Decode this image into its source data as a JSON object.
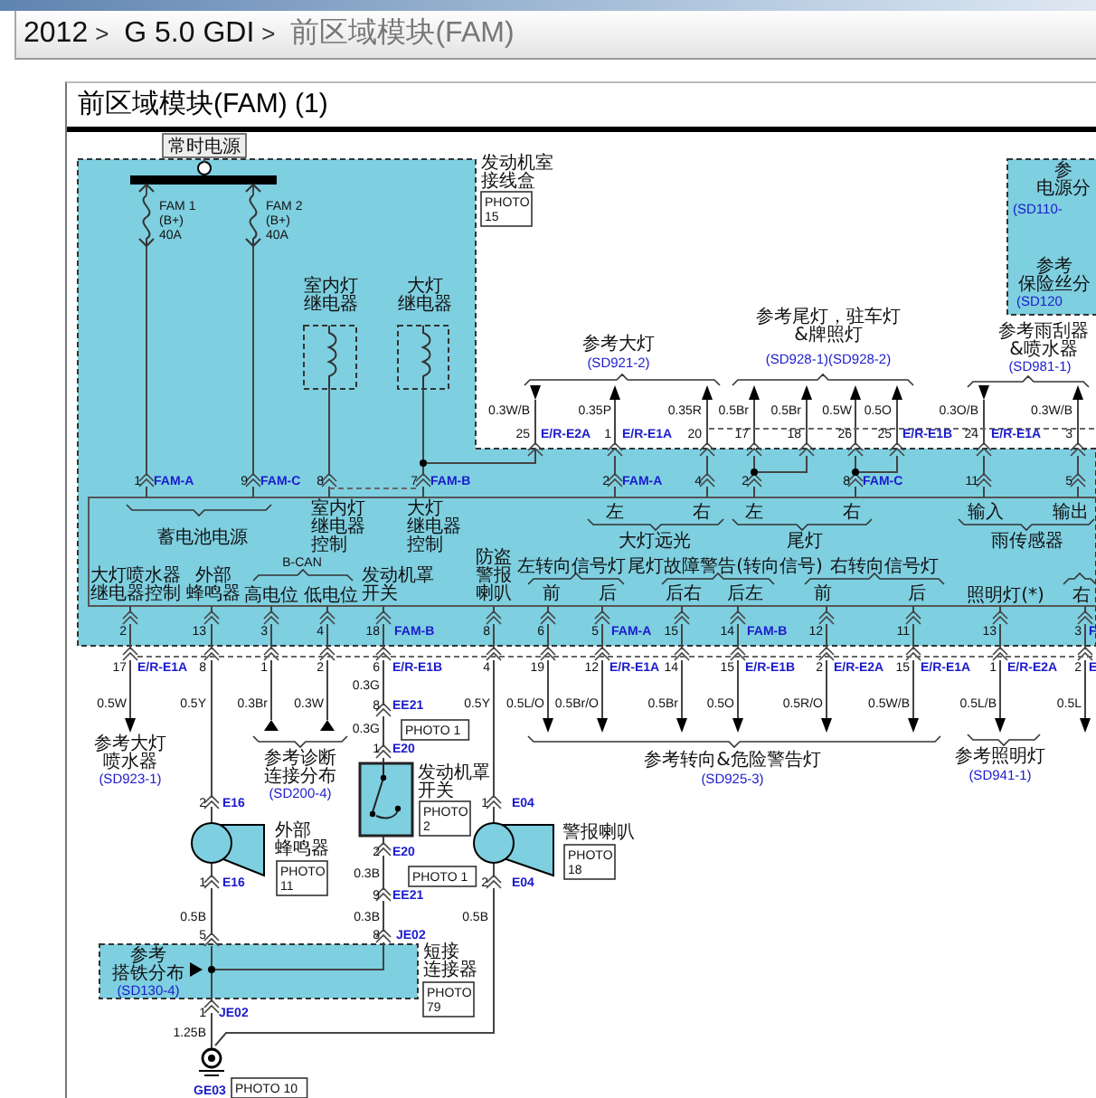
{
  "breadcrumb": {
    "separator": ">",
    "items": [
      {
        "text": "2012",
        "current": false
      },
      {
        "text": "G 5.0 GDI",
        "current": false
      },
      {
        "text": "前区域模块(FAM)",
        "current": true
      }
    ]
  },
  "panel": {
    "title": "前区域模块(FAM) (1)"
  },
  "diagram": {
    "labels": [
      {
        "kind": "tag",
        "text": "常时电源"
      },
      {
        "kind": "code",
        "lines": [
          "FAM 1",
          "(B+)",
          "40A"
        ]
      },
      {
        "kind": "code",
        "lines": [
          "FAM 2",
          "(B+)",
          "40A"
        ]
      },
      {
        "kind": "label",
        "lines": [
          "发动机室",
          "接线盒"
        ]
      },
      {
        "kind": "photo",
        "lines": [
          "PHOTO",
          "15"
        ]
      },
      {
        "kind": "label",
        "lines": [
          "室内灯",
          "继电器"
        ]
      },
      {
        "kind": "label",
        "lines": [
          "大灯",
          "继电器"
        ]
      },
      {
        "kind": "label",
        "lines": [
          "参",
          "电源分"
        ]
      },
      {
        "kind": "ref",
        "text": "(SD110-"
      },
      {
        "kind": "label",
        "lines": [
          "参考",
          "保险丝分"
        ]
      },
      {
        "kind": "ref",
        "text": "(SD120"
      },
      {
        "kind": "label",
        "text": "参考大灯"
      },
      {
        "kind": "ref",
        "text": "(SD921-2)"
      },
      {
        "kind": "label",
        "lines": [
          "参考尾灯，驻车灯",
          "&牌照灯"
        ]
      },
      {
        "kind": "ref",
        "text": "(SD928-1)(SD928-2)"
      },
      {
        "kind": "label",
        "lines": [
          "参考雨刮器",
          "&喷水器"
        ]
      },
      {
        "kind": "ref",
        "text": "(SD981-1)"
      },
      {
        "kind": "code",
        "text": "0.3W/B"
      },
      {
        "kind": "code",
        "text": "0.35P"
      },
      {
        "kind": "code",
        "text": "0.35R"
      },
      {
        "kind": "code",
        "text": "0.5Br"
      },
      {
        "kind": "code",
        "text": "0.5Br"
      },
      {
        "kind": "code",
        "text": "0.5W"
      },
      {
        "kind": "code",
        "text": "0.5O"
      },
      {
        "kind": "code",
        "text": "0.3O/B"
      },
      {
        "kind": "code",
        "text": "0.3W/B"
      },
      {
        "kind": "code",
        "text": "25"
      },
      {
        "kind": "connector",
        "text": "E/R-E2A"
      },
      {
        "kind": "code",
        "text": "1"
      },
      {
        "kind": "connector",
        "text": "E/R-E1A"
      },
      {
        "kind": "code",
        "text": "20"
      },
      {
        "kind": "code",
        "text": "17"
      },
      {
        "kind": "code",
        "text": "18"
      },
      {
        "kind": "code",
        "text": "26"
      },
      {
        "kind": "code",
        "text": "25"
      },
      {
        "kind": "connector",
        "text": "E/R-E1B"
      },
      {
        "kind": "code",
        "text": "24"
      },
      {
        "kind": "connector",
        "text": "E/R-E1A"
      },
      {
        "kind": "code",
        "text": "3"
      },
      {
        "kind": "code",
        "text": "1"
      },
      {
        "kind": "connector",
        "text": "FAM-A"
      },
      {
        "kind": "code",
        "text": "9"
      },
      {
        "kind": "connector",
        "text": "FAM-C"
      },
      {
        "kind": "code",
        "text": "8"
      },
      {
        "kind": "code",
        "text": "7"
      },
      {
        "kind": "connector",
        "text": "FAM-B"
      },
      {
        "kind": "code",
        "text": "2"
      },
      {
        "kind": "connector",
        "text": "FAM-A"
      },
      {
        "kind": "code",
        "text": "4"
      },
      {
        "kind": "code",
        "text": "2"
      },
      {
        "kind": "code",
        "text": "8"
      },
      {
        "kind": "connector",
        "text": "FAM-C"
      },
      {
        "kind": "code",
        "text": "11"
      },
      {
        "kind": "code",
        "text": "5"
      },
      {
        "kind": "label",
        "text": "蓄电池电源"
      },
      {
        "kind": "label",
        "lines": [
          "室内灯",
          "继电器",
          "控制"
        ]
      },
      {
        "kind": "label",
        "lines": [
          "大灯",
          "继电器",
          "控制"
        ]
      },
      {
        "kind": "label",
        "text": "左"
      },
      {
        "kind": "label",
        "text": "右"
      },
      {
        "kind": "label",
        "text": "左"
      },
      {
        "kind": "label",
        "text": "右"
      },
      {
        "kind": "label",
        "text": "大灯远光"
      },
      {
        "kind": "label",
        "text": "尾灯"
      },
      {
        "kind": "label",
        "text": "输入"
      },
      {
        "kind": "label",
        "text": "输出"
      },
      {
        "kind": "label",
        "text": "雨传感器"
      },
      {
        "kind": "label",
        "lines": [
          "大灯喷水器",
          "继电器控制"
        ]
      },
      {
        "kind": "label",
        "lines": [
          "外部",
          "蜂鸣器"
        ]
      },
      {
        "kind": "code",
        "text": "B-CAN"
      },
      {
        "kind": "label",
        "text": "高电位"
      },
      {
        "kind": "label",
        "text": "低电位"
      },
      {
        "kind": "label",
        "lines": [
          "发动机罩",
          "开关"
        ]
      },
      {
        "kind": "label",
        "lines": [
          "防盗",
          "警报",
          "喇叭"
        ]
      },
      {
        "kind": "label",
        "text": "左转向信号灯"
      },
      {
        "kind": "label",
        "text": "前"
      },
      {
        "kind": "label",
        "text": "后"
      },
      {
        "kind": "label",
        "text": "尾灯故障警告(转向信号)"
      },
      {
        "kind": "label",
        "text": "后右"
      },
      {
        "kind": "label",
        "text": "后左"
      },
      {
        "kind": "label",
        "text": "右转向信号灯"
      },
      {
        "kind": "label",
        "text": "前"
      },
      {
        "kind": "label",
        "text": "后"
      },
      {
        "kind": "label",
        "text": "照明灯(*)"
      },
      {
        "kind": "label",
        "text": "右"
      },
      {
        "kind": "code",
        "text": "2"
      },
      {
        "kind": "code",
        "text": "13"
      },
      {
        "kind": "code",
        "text": "3"
      },
      {
        "kind": "code",
        "text": "4"
      },
      {
        "kind": "code",
        "text": "18"
      },
      {
        "kind": "connector",
        "text": "FAM-B"
      },
      {
        "kind": "code",
        "text": "8"
      },
      {
        "kind": "code",
        "text": "6"
      },
      {
        "kind": "code",
        "text": "5"
      },
      {
        "kind": "connector",
        "text": "FAM-A"
      },
      {
        "kind": "code",
        "text": "15"
      },
      {
        "kind": "code",
        "text": "14"
      },
      {
        "kind": "connector",
        "text": "FAM-B"
      },
      {
        "kind": "code",
        "text": "12"
      },
      {
        "kind": "code",
        "text": "11"
      },
      {
        "kind": "code",
        "text": "13"
      },
      {
        "kind": "code",
        "text": "3"
      },
      {
        "kind": "connector",
        "text": "F"
      },
      {
        "kind": "code",
        "text": "17"
      },
      {
        "kind": "connector",
        "text": "E/R-E1A"
      },
      {
        "kind": "code",
        "text": "8"
      },
      {
        "kind": "code",
        "text": "1"
      },
      {
        "kind": "code",
        "text": "2"
      },
      {
        "kind": "code",
        "text": "6"
      },
      {
        "kind": "connector",
        "text": "E/R-E1B"
      },
      {
        "kind": "code",
        "text": "4"
      },
      {
        "kind": "code",
        "text": "19"
      },
      {
        "kind": "code",
        "text": "12"
      },
      {
        "kind": "connector",
        "text": "E/R-E1A"
      },
      {
        "kind": "code",
        "text": "14"
      },
      {
        "kind": "code",
        "text": "15"
      },
      {
        "kind": "connector",
        "text": "E/R-E1B"
      },
      {
        "kind": "code",
        "text": "2"
      },
      {
        "kind": "connector",
        "text": "E/R-E2A"
      },
      {
        "kind": "code",
        "text": "15"
      },
      {
        "kind": "connector",
        "text": "E/R-E1A"
      },
      {
        "kind": "code",
        "text": "1"
      },
      {
        "kind": "connector",
        "text": "E/R-E2A"
      },
      {
        "kind": "code",
        "text": "2"
      },
      {
        "kind": "connector",
        "text": "E"
      },
      {
        "kind": "code",
        "text": "0.5W"
      },
      {
        "kind": "code",
        "text": "0.5Y"
      },
      {
        "kind": "code",
        "text": "0.3Br"
      },
      {
        "kind": "code",
        "text": "0.3W"
      },
      {
        "kind": "code",
        "text": "0.3G"
      },
      {
        "kind": "code",
        "text": "0.5Y"
      },
      {
        "kind": "code",
        "text": "0.5L/O"
      },
      {
        "kind": "code",
        "text": "0.5Br/O"
      },
      {
        "kind": "code",
        "text": "0.5Br"
      },
      {
        "kind": "code",
        "text": "0.5O"
      },
      {
        "kind": "code",
        "text": "0.5R/O"
      },
      {
        "kind": "code",
        "text": "0.5W/B"
      },
      {
        "kind": "code",
        "text": "0.5L/B"
      },
      {
        "kind": "code",
        "text": "0.5L"
      },
      {
        "kind": "label",
        "lines": [
          "参考大灯",
          "喷水器"
        ]
      },
      {
        "kind": "ref",
        "text": "(SD923-1)"
      },
      {
        "kind": "label",
        "lines": [
          "参考诊断",
          "连接分布"
        ]
      },
      {
        "kind": "ref",
        "text": "(SD200-4)"
      },
      {
        "kind": "label",
        "text": "参考转向&危险警告灯"
      },
      {
        "kind": "ref",
        "text": "(SD925-3)"
      },
      {
        "kind": "label",
        "text": "参考照明灯"
      },
      {
        "kind": "ref",
        "text": "(SD941-1)"
      },
      {
        "kind": "code",
        "text": "8"
      },
      {
        "kind": "connector",
        "text": "EE21"
      },
      {
        "kind": "photo",
        "text": "PHOTO 1"
      },
      {
        "kind": "code",
        "text": "0.3G"
      },
      {
        "kind": "code",
        "text": "1"
      },
      {
        "kind": "connector",
        "text": "E20"
      },
      {
        "kind": "label",
        "lines": [
          "发动机罩",
          "开关"
        ]
      },
      {
        "kind": "photo",
        "lines": [
          "PHOTO",
          "2"
        ]
      },
      {
        "kind": "code",
        "text": "2"
      },
      {
        "kind": "connector",
        "text": "E20"
      },
      {
        "kind": "code",
        "text": "0.3B"
      },
      {
        "kind": "photo",
        "text": "PHOTO 1"
      },
      {
        "kind": "code",
        "text": "9"
      },
      {
        "kind": "connector",
        "text": "EE21"
      },
      {
        "kind": "code",
        "text": "0.3B"
      },
      {
        "kind": "code",
        "text": "8"
      },
      {
        "kind": "connector",
        "text": "JE02"
      },
      {
        "kind": "code",
        "text": "2"
      },
      {
        "kind": "connector",
        "text": "E16"
      },
      {
        "kind": "label",
        "lines": [
          "外部",
          "蜂鸣器"
        ]
      },
      {
        "kind": "code",
        "text": "1"
      },
      {
        "kind": "connector",
        "text": "E16"
      },
      {
        "kind": "photo",
        "lines": [
          "PHOTO",
          "11"
        ]
      },
      {
        "kind": "code",
        "text": "0.5B"
      },
      {
        "kind": "code",
        "text": "5"
      },
      {
        "kind": "code",
        "text": "1"
      },
      {
        "kind": "connector",
        "text": "E04"
      },
      {
        "kind": "label",
        "text": "警报喇叭"
      },
      {
        "kind": "photo",
        "lines": [
          "PHOTO",
          "18"
        ]
      },
      {
        "kind": "code",
        "text": "2"
      },
      {
        "kind": "connector",
        "text": "E04"
      },
      {
        "kind": "code",
        "text": "0.5B"
      },
      {
        "kind": "label",
        "lines": [
          "参考",
          "搭铁分布"
        ]
      },
      {
        "kind": "ref",
        "text": "(SD130-4)"
      },
      {
        "kind": "label",
        "lines": [
          "短接",
          "连接器"
        ]
      },
      {
        "kind": "photo",
        "lines": [
          "PHOTO",
          "79"
        ]
      },
      {
        "kind": "code",
        "text": "1"
      },
      {
        "kind": "connector",
        "text": "JE02"
      },
      {
        "kind": "code",
        "text": "1.25B"
      },
      {
        "kind": "connector",
        "text": "GE03"
      },
      {
        "kind": "photo",
        "text": "PHOTO 10"
      }
    ]
  }
}
